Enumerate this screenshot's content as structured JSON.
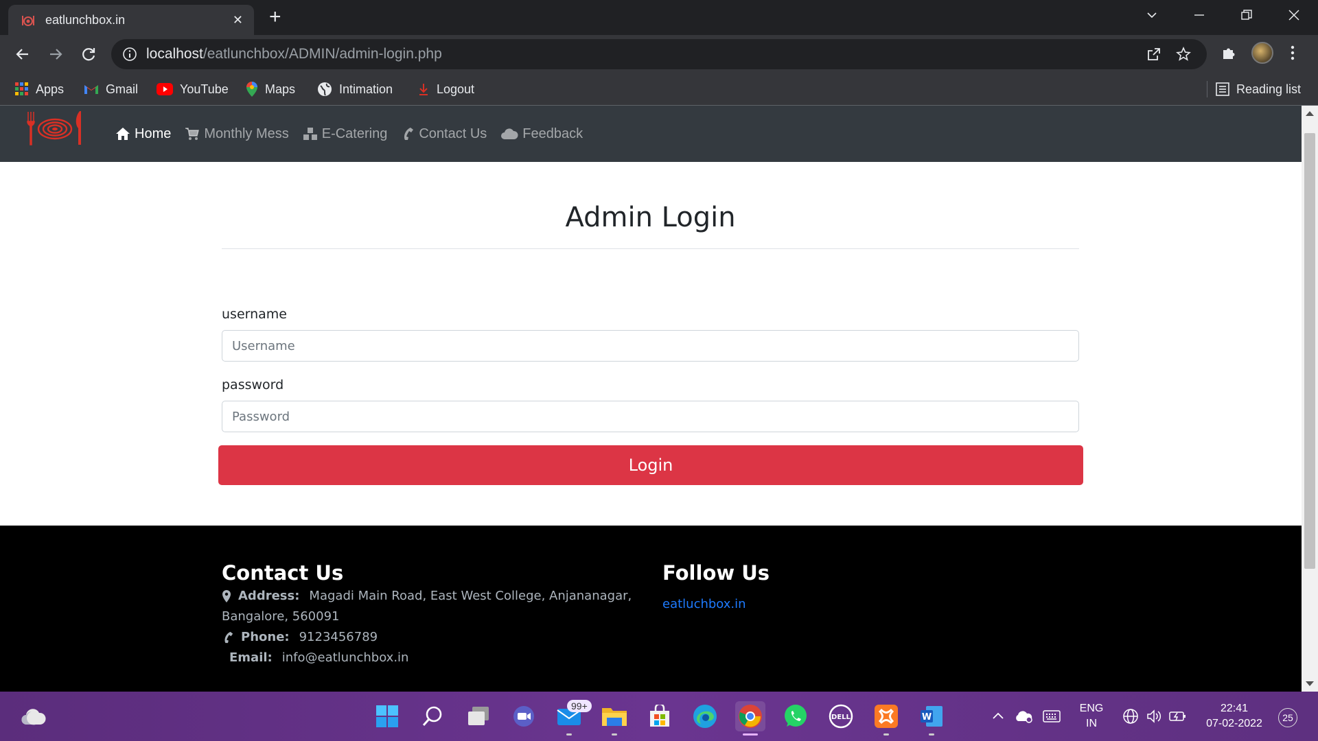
{
  "browser": {
    "tab_title": "eatlunchbox.in",
    "url_host": "localhost",
    "url_path": "/eatlunchbox/ADMIN/admin-login.php",
    "bookmarks": [
      {
        "label": "Apps",
        "icon": "apps-grid-icon"
      },
      {
        "label": "Gmail",
        "icon": "gmail-icon"
      },
      {
        "label": "YouTube",
        "icon": "youtube-icon"
      },
      {
        "label": "Maps",
        "icon": "maps-icon"
      },
      {
        "label": "Intimation",
        "icon": "globe-icon"
      },
      {
        "label": "Logout",
        "icon": "download-arrow-icon"
      }
    ],
    "reading_list": "Reading list"
  },
  "site_nav": {
    "items": [
      {
        "label": "Home",
        "icon": "home-icon",
        "active": true
      },
      {
        "label": "Monthly Mess",
        "icon": "cart-icon"
      },
      {
        "label": "E-Catering",
        "icon": "cubes-icon"
      },
      {
        "label": "Contact Us",
        "icon": "phone-icon"
      },
      {
        "label": "Feedback",
        "icon": "cloud-icon"
      }
    ]
  },
  "login": {
    "title": "Admin Login",
    "username_label": "username",
    "username_placeholder": "Username",
    "password_label": "password",
    "password_placeholder": "Password",
    "submit_label": "Login"
  },
  "footer": {
    "contact_heading": "Contact Us",
    "address_label": "Address:",
    "address_line1": "Magadi Main Road, East West College, Anjananagar,",
    "address_line2": "Bangalore, 560091",
    "phone_label": "Phone:",
    "phone_value": "9123456789",
    "email_label": "Email:",
    "email_value": "info@eatlunchbox.in",
    "follow_heading": "Follow Us",
    "follow_link": "eatluchbox.in"
  },
  "taskbar": {
    "mail_badge": "99+",
    "lang_top": "ENG",
    "lang_bottom": "IN",
    "time": "22:41",
    "date": "07-02-2022",
    "notification_count": "25"
  },
  "colors": {
    "brand_red": "#dc3545",
    "navbar_bg": "#343a40",
    "footer_bg": "#000000",
    "link_blue": "#1e7bff"
  }
}
